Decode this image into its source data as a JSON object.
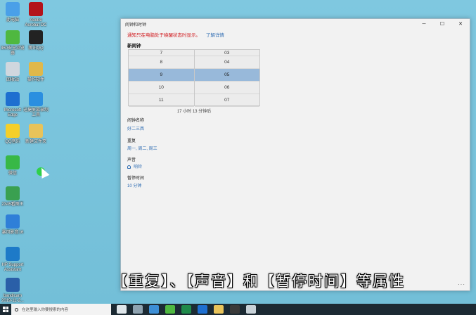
{
  "desktop": {
    "icons": [
      {
        "label": "此电脑",
        "color": "#4aa0e8"
      },
      {
        "label": "Adobe\nAcrobat DC",
        "color": "#b3131a"
      },
      {
        "label": "360安全浏览\n器",
        "color": "#4fb840"
      },
      {
        "label": "腾讯QQ",
        "color": "#222222"
      },
      {
        "label": "回收站",
        "color": "#d0d7de"
      },
      {
        "label": "操作软件",
        "color": "#e0b84a"
      },
      {
        "label": "Microsoft\nEdge",
        "color": "#1e6fd0"
      },
      {
        "label": "迅捷屏幕录制\n工具",
        "color": "#2b8fe0"
      },
      {
        "label": "QQ音乐",
        "color": "#f4cf2a"
      },
      {
        "label": "新建文件夹",
        "color": "#e8c35a"
      },
      {
        "label": "微信",
        "color": "#38b846"
      },
      {
        "label": "2345看图王",
        "color": "#3aa050"
      },
      {
        "label": "暴风影音16",
        "color": "#2f7fd8"
      },
      {
        "label": "HP Support\nAssistant",
        "color": "#1d7ac8"
      },
      {
        "label": "bandicam\n2019-11-2...",
        "color": "#2a5fa8"
      }
    ]
  },
  "window": {
    "title": "闹钟和时钟",
    "notice": "通知只在电脑处于唤醒状态时显示。",
    "notice_link": "了解详情",
    "section_title": "新闹钟",
    "hours": [
      "7",
      "8",
      "9",
      "10",
      "11"
    ],
    "minutes": [
      "03",
      "04",
      "05",
      "06",
      "07"
    ],
    "selected_hour": "9",
    "selected_minute": "05",
    "remaining": "17 小时 13 分钟后",
    "name_label": "闹钟名称",
    "name_value": "好二三西",
    "repeat_label": "重复",
    "repeat_value": "周一, 周二, 周三",
    "sound_label": "声音",
    "sound_value": "响铃",
    "snooze_label": "暂停时间",
    "snooze_value": "10 分钟",
    "controls": {
      "minimize": "─",
      "maximize": "☐",
      "close": "✕"
    },
    "more": "···"
  },
  "subtitle": "【重复】、【声音】和【暂停时间】等属性",
  "taskbar": {
    "search_placeholder": "在这里输入你要搜索的内容",
    "items": [
      {
        "name": "task-view",
        "color": "#dfe6ea"
      },
      {
        "name": "settings",
        "color": "#8fa3b0"
      },
      {
        "name": "store",
        "color": "#3d8fd6"
      },
      {
        "name": "360-browser",
        "color": "#4fb840"
      },
      {
        "name": "excel",
        "color": "#1f8a4a"
      },
      {
        "name": "edge",
        "color": "#1e6fd0"
      },
      {
        "name": "file-explorer",
        "color": "#e8c35a"
      },
      {
        "name": "qq",
        "color": "#3a3a3a"
      },
      {
        "name": "alarms",
        "color": "#c8d2d8"
      }
    ]
  }
}
